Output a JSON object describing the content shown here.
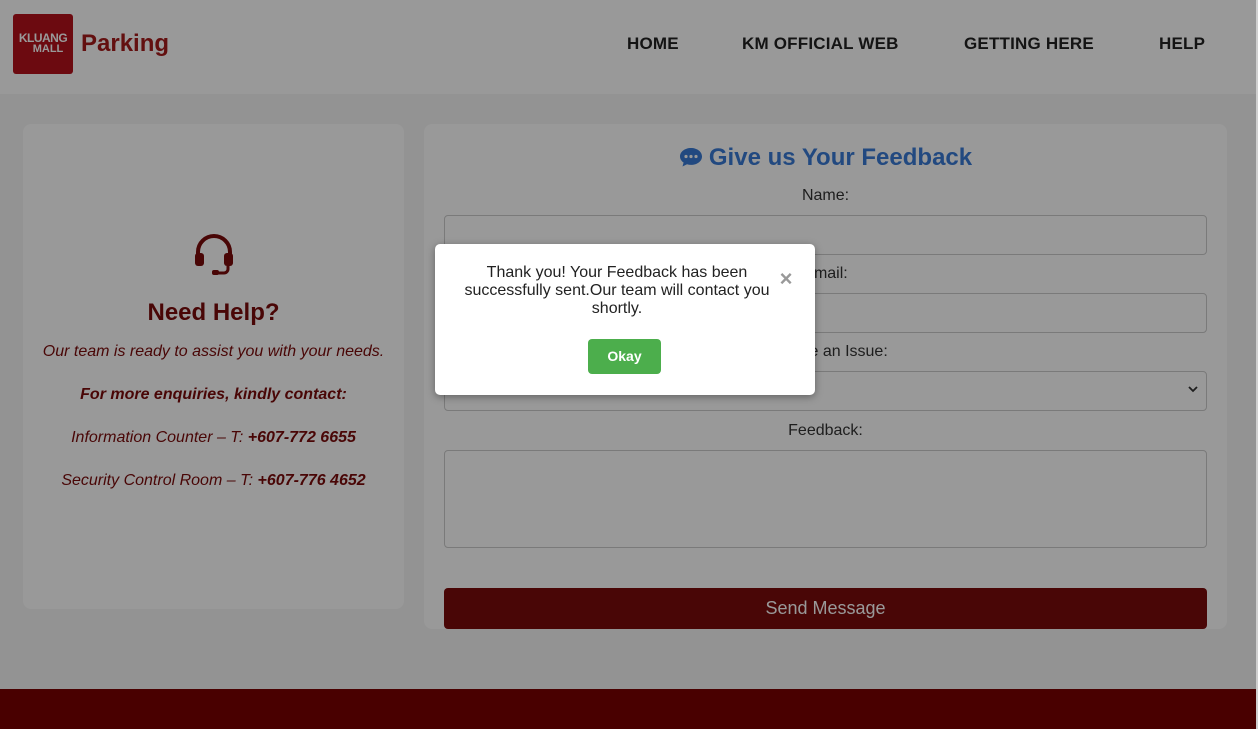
{
  "header": {
    "logo": {
      "line1": "KLUANG",
      "line2": "MALL"
    },
    "brand": "Parking",
    "nav": [
      "HOME",
      "KM OFFICIAL WEB",
      "GETTING HERE",
      "HELP"
    ]
  },
  "help": {
    "icon": "headset-icon",
    "title": "Need Help?",
    "subtitle": "Our team is ready to assist you with your needs.",
    "enquiries": "For more enquiries, kindly contact:",
    "contacts": [
      {
        "label": "Information Counter – T: ",
        "phone": "+607-772 6655"
      },
      {
        "label": "Security Control Room – T: ",
        "phone": "+607-776 4652"
      }
    ]
  },
  "feedback": {
    "icon": "chat-icon",
    "title": "Give us Your Feedback",
    "name_label": "Name:",
    "email_label": "Email:",
    "issue_label": "Choose an Issue:",
    "issue_selected": "Select an Issue",
    "feedback_label": "Feedback:",
    "send_label": "Send Message"
  },
  "modal": {
    "message": "Thank you! Your Feedback has been successfully sent.Our team will contact you shortly.",
    "close_icon": "close-icon",
    "okay_label": "Okay"
  },
  "colors": {
    "brand_red": "#a51b1b",
    "dark_red": "#7a0a0a",
    "accent_blue": "#3a7bd5",
    "ok_green": "#4cae4c"
  }
}
